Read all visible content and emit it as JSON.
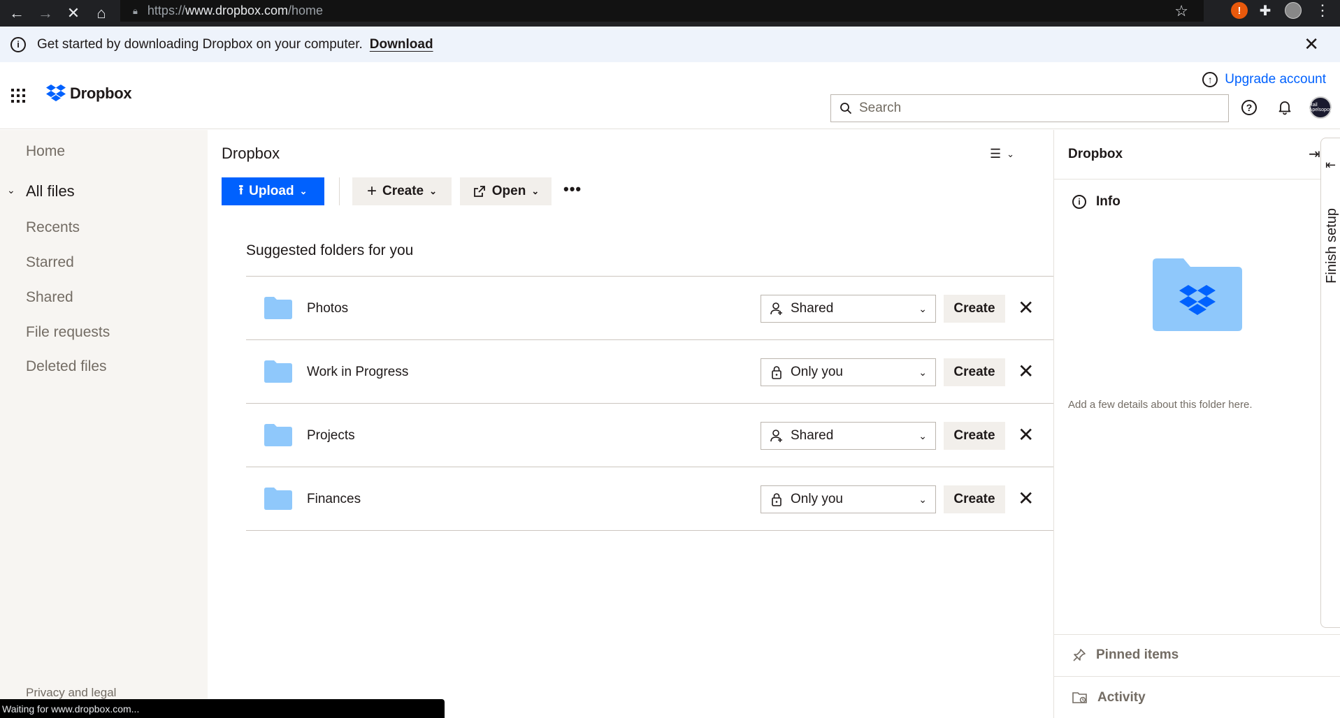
{
  "browser": {
    "url_prefix": "https://",
    "url_host": "www.dropbox.com",
    "url_path": "/home",
    "status": "Waiting for www.dropbox.com..."
  },
  "banner": {
    "message": "Get started by downloading Dropbox on your computer.",
    "link": "Download"
  },
  "header": {
    "brand": "Dropbox",
    "upgrade": "Upgrade account",
    "search_placeholder": "Search",
    "avatar_text": "Rail Apelsopov"
  },
  "sidebar": {
    "items": [
      {
        "label": "Home"
      },
      {
        "label": "All files"
      },
      {
        "label": "Recents"
      },
      {
        "label": "Starred"
      },
      {
        "label": "Shared"
      },
      {
        "label": "File requests"
      },
      {
        "label": "Deleted files"
      }
    ],
    "footer": "Privacy and legal"
  },
  "main": {
    "title": "Dropbox",
    "upload": "Upload",
    "create": "Create",
    "open": "Open",
    "suggested_title": "Suggested folders for you",
    "folders": [
      {
        "name": "Photos",
        "sharing": "Shared",
        "sharing_icon": "shared-person-icon",
        "action": "Create"
      },
      {
        "name": "Work in Progress",
        "sharing": "Only you",
        "sharing_icon": "lock-icon",
        "action": "Create"
      },
      {
        "name": "Projects",
        "sharing": "Shared",
        "sharing_icon": "shared-person-icon",
        "action": "Create"
      },
      {
        "name": "Finances",
        "sharing": "Only you",
        "sharing_icon": "lock-icon",
        "action": "Create"
      }
    ]
  },
  "panel": {
    "title": "Dropbox",
    "info": "Info",
    "description": "Add a few details about this folder here.",
    "pinned": "Pinned items",
    "activity": "Activity"
  },
  "finish_setup": "Finish setup",
  "colors": {
    "accent": "#0061fe",
    "folder": "#8fc8fb",
    "sidebar_bg": "#f7f5f2",
    "banner_bg": "#eef3fb"
  }
}
